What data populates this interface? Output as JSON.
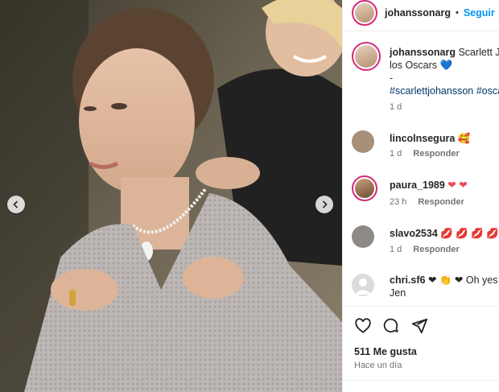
{
  "post": {
    "username": "johanssonarg",
    "separator": "•",
    "follow_label": "Seguir"
  },
  "caption": {
    "username": "johanssonarg",
    "text": "Scarlett Jo",
    "line2": "los Oscars",
    "line2_emoji": "💙",
    "dash": "-",
    "hashtags": "#scarlettjohansson #oscar",
    "age": "1 d"
  },
  "comments": [
    {
      "username": "lincolnsegura",
      "text": "🥰",
      "age": "1 d",
      "reply": "Responder"
    },
    {
      "username": "paura_1989",
      "text": "❤ ❤",
      "age": "23 h",
      "reply": "Responder"
    },
    {
      "username": "slavo2534",
      "text": "💋 💋 💋 💋 💋",
      "age": "1 d",
      "reply": "Responder"
    },
    {
      "username": "chri.sf6",
      "text": "❤ 👏 ❤ Oh yes",
      "text_line2": "Jen"
    }
  ],
  "likes": "511 Me gusta",
  "timestamp": "Hace un día",
  "colors": {
    "accent": "#0095f6",
    "ring": "#d62976",
    "muted": "#737373"
  },
  "icons": [
    "heart-icon",
    "comment-icon",
    "share-icon",
    "chevron-left-icon",
    "chevron-right-icon"
  ]
}
